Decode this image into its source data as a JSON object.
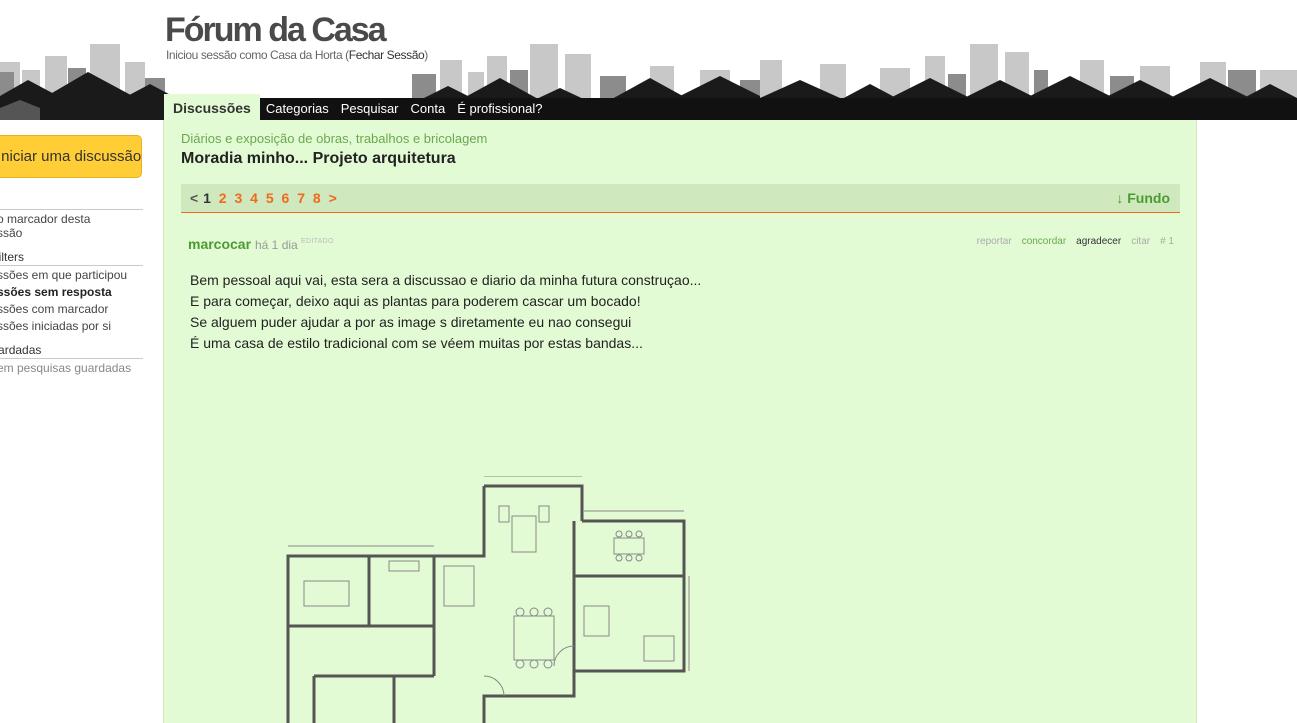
{
  "header": {
    "site_title": "Fórum da Casa",
    "session_prefix": "Iniciou sessão como Casa da Horta (",
    "logout_label": "Fechar Sessão",
    "session_suffix": ")"
  },
  "nav": {
    "tabs": [
      {
        "label": "Discussões",
        "active": true
      },
      {
        "label": "Categorias"
      },
      {
        "label": "Pesquisar"
      },
      {
        "label": "Conta"
      },
      {
        "label": "É profissional?"
      }
    ]
  },
  "sidebar": {
    "start_button": "Iniciar uma discussão",
    "bookmarks_heading": "s",
    "bookmark_link_1": "o marcador desta",
    "bookmark_link_2": "ssão",
    "filters_heading": "ssion Filters",
    "filters": [
      "ssões em que participou",
      "ssões sem resposta",
      "ssões com marcador",
      "ssões iniciadas por si"
    ],
    "saved_heading": "isas guardadas",
    "saved_empty": "em pesquisas guardadas"
  },
  "discussion": {
    "category": "Diários e exposição de obras, trabalhos e bricolagem",
    "title": "Moradia minho... Projeto arquitetura",
    "pager": {
      "prev": "<",
      "current": "1",
      "pages": [
        "2",
        "3",
        "4",
        "5",
        "6",
        "7",
        "8"
      ],
      "next": ">"
    },
    "to_bottom": "↓ Fundo"
  },
  "post": {
    "author": "marcocar",
    "time": "há 1 dia",
    "edited": "EDITADO",
    "actions": {
      "report": "reportar",
      "agree": "concordar",
      "thank": "agradecer",
      "quote": "citar",
      "number": "# 1"
    },
    "body": [
      "Bem pessoal aqui vai, esta sera a discussao e diario da minha futura construçao...",
      "E para começar, deixo aqui as plantas para poderem cascar um bocado!",
      "Se alguem puder ajudar a por as image s diretamente eu nao consegui",
      "É uma casa de estilo tradicional com se véem muitas por estas bandas..."
    ]
  },
  "colors": {
    "content_bg": "#e3fbd4",
    "accent_green": "#4a9b32",
    "pager_orange": "#f06a1d",
    "start_button": "#ffcd35"
  }
}
